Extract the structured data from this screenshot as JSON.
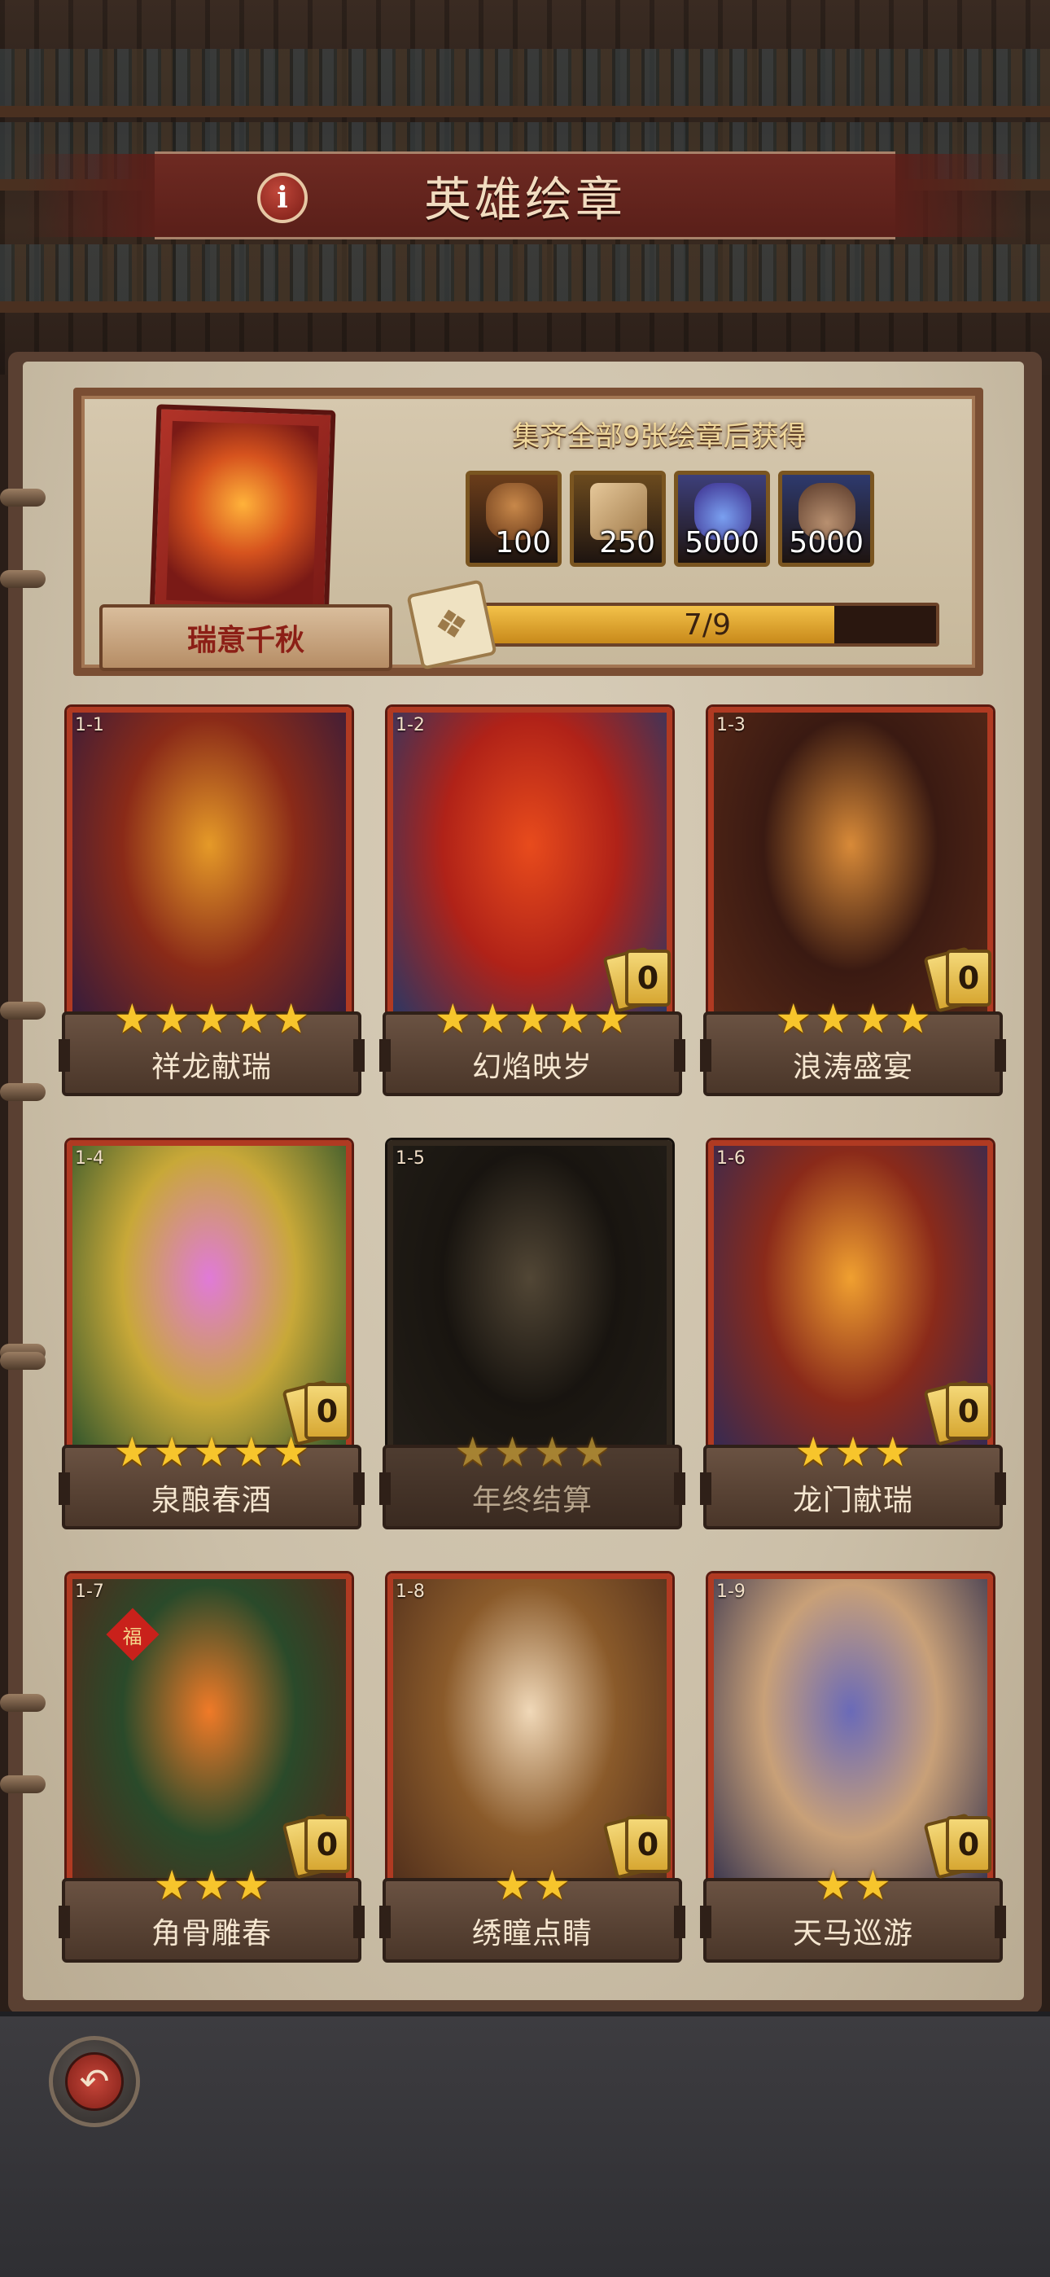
{
  "header": {
    "title": "英雄绘章",
    "info_icon": "info-icon"
  },
  "reward": {
    "card_name": "瑞意千秋",
    "caption": "集齐全部9张绘章后获得",
    "items": [
      {
        "icon": "armor-chest-icon",
        "qty": "100",
        "bg": "#6b3d1a"
      },
      {
        "icon": "scroll-icon",
        "qty": "250",
        "bg": "#6b4a1e"
      },
      {
        "icon": "potion-bottles-icon",
        "qty": "5000",
        "bg": "#3d3f7a"
      },
      {
        "icon": "ore-pile-icon",
        "qty": "5000",
        "bg": "#2e3a6e"
      }
    ],
    "progress": {
      "current": 7,
      "total": 9,
      "text": "7/9"
    }
  },
  "cards": [
    {
      "num": "1-1",
      "name": "祥龙献瑞",
      "stars": 5,
      "count": null,
      "locked": false,
      "palette": [
        "#2a1a40",
        "#e59a28",
        "#8a2a18"
      ]
    },
    {
      "num": "1-2",
      "name": "幻焰映岁",
      "stars": 5,
      "count": "0",
      "locked": false,
      "palette": [
        "#1a3a6e",
        "#e84b1c",
        "#b02218"
      ]
    },
    {
      "num": "1-3",
      "name": "浪涛盛宴",
      "stars": 4,
      "count": "0",
      "locked": false,
      "palette": [
        "#5a2a18",
        "#d88a38",
        "#3a1a12"
      ]
    },
    {
      "num": "1-4",
      "name": "泉酿春酒",
      "stars": 5,
      "count": "0",
      "locked": false,
      "palette": [
        "#1d4a2a",
        "#e07ad8",
        "#c8a838"
      ]
    },
    {
      "num": "1-5",
      "name": "年终结算",
      "stars": 4,
      "count": null,
      "locked": true,
      "palette": [
        "#3a3028",
        "#8a7050",
        "#2a2018"
      ]
    },
    {
      "num": "1-6",
      "name": "龙门献瑞",
      "stars": 3,
      "count": "0",
      "locked": false,
      "palette": [
        "#2a2a5a",
        "#f0a030",
        "#8a2a1a"
      ]
    },
    {
      "num": "1-7",
      "name": "角骨雕春",
      "stars": 3,
      "count": "0",
      "locked": false,
      "palette": [
        "#5a2218",
        "#f07a28",
        "#2a4a2a"
      ],
      "badge": "福"
    },
    {
      "num": "1-8",
      "name": "绣瞳点睛",
      "stars": 2,
      "count": "0",
      "locked": false,
      "palette": [
        "#4a2a1a",
        "#f0d8b8",
        "#8a5a2a"
      ]
    },
    {
      "num": "1-9",
      "name": "天马巡游",
      "stars": 2,
      "count": "0",
      "locked": false,
      "palette": [
        "#2a2a4a",
        "#6a6ab8",
        "#c8a078"
      ]
    }
  ],
  "footer": {
    "back_icon": "back-arrow-icon"
  }
}
